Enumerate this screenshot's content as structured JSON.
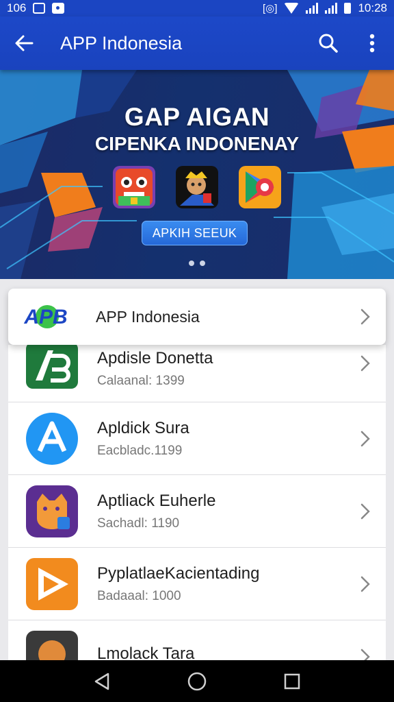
{
  "status_bar": {
    "left_text": "106",
    "time": "10:28"
  },
  "app_bar": {
    "title": "APP Indonesia",
    "back_icon": "arrow-left-icon",
    "search_icon": "search-icon",
    "more_icon": "more-vert-icon"
  },
  "banner": {
    "title_line1": "GAP AIGAN",
    "title_line2": "CIPENKA INDONENAY",
    "cta_label": "APKIH SEEUK",
    "page_indicator": {
      "pages": 2,
      "current": 1
    }
  },
  "featured": {
    "logo_text": "APB",
    "label": "APP Indonesia"
  },
  "apps": [
    {
      "name": "Apdisle Donetta",
      "sub": "Calaanal: 1399",
      "icon": "green-ab-icon",
      "color": "#1f7a3c"
    },
    {
      "name": "Apldick Sura",
      "sub": "Eacbladc.1199",
      "icon": "blue-a-icon",
      "color": "#2196f3"
    },
    {
      "name": "Aptliack Euherle",
      "sub": "Sachadl: 1190",
      "icon": "purple-cat-icon",
      "color": "#5b2e91"
    },
    {
      "name": "PyplatlaeKacientading",
      "sub": "Badaaal: 1000",
      "icon": "orange-play-icon",
      "color": "#f28b1e"
    },
    {
      "name": "Lmolack Tara",
      "sub": "",
      "icon": "dark-face-icon",
      "color": "#3a3a3a"
    }
  ],
  "nav": {
    "back": "triangle-back-icon",
    "home": "circle-home-icon",
    "recents": "square-recents-icon"
  }
}
